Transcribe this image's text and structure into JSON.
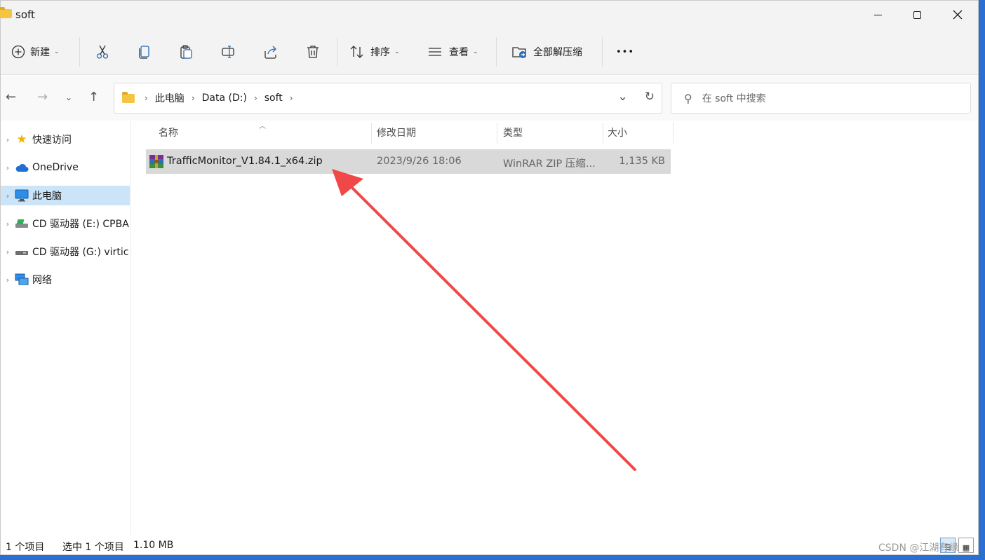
{
  "window": {
    "title": "soft"
  },
  "toolbar": {
    "new_label": "新建",
    "sort_label": "排序",
    "view_label": "查看",
    "extract_label": "全部解压缩",
    "more_label": "•••"
  },
  "nav": {
    "breadcrumbs": [
      "此电脑",
      "Data (D:)",
      "soft"
    ],
    "search_placeholder": "在 soft 中搜索"
  },
  "sidebar": {
    "items": [
      {
        "label": "快速访问",
        "icon": "star-icon"
      },
      {
        "label": "OneDrive",
        "icon": "cloud-icon"
      },
      {
        "label": "此电脑",
        "icon": "computer-icon",
        "selected": true
      },
      {
        "label": "CD 驱动器 (E:) CPBA",
        "icon": "cd-drive-icon"
      },
      {
        "label": "CD 驱动器 (G:) virtic",
        "icon": "cd-drive-icon"
      },
      {
        "label": "网络",
        "icon": "network-icon"
      }
    ]
  },
  "columns": {
    "name": "名称",
    "modified": "修改日期",
    "type": "类型",
    "size": "大小"
  },
  "files": [
    {
      "name": "TrafficMonitor_V1.84.1_x64.zip",
      "modified": "2023/9/26 18:06",
      "type": "WinRAR ZIP 压缩...",
      "size": "1,135 KB",
      "selected": true
    }
  ],
  "status": {
    "count": "1 个项目",
    "selection": "选中 1 个项目",
    "selection_size": "1.10 MB"
  },
  "watermark": "CSDN @江湖有缘",
  "colors": {
    "arrow": "#f04848",
    "selection": "#d9d9d9",
    "nav_selected": "#cce4f7"
  }
}
